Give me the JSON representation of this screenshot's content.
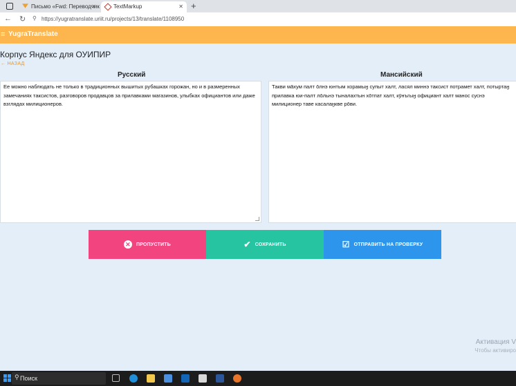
{
  "browser": {
    "tabs": [
      {
        "title": "Письмо «Fwd: Переводчики и э",
        "active": false
      },
      {
        "title": "TextMarkup",
        "active": true
      }
    ],
    "new_tab": "+",
    "url": "https://yugratranslate.uriit.ru/projects/13/translate/1108950"
  },
  "app": {
    "brand": "YugraTranslate",
    "page_title": "Корпус Яндекс для ОУИПИР",
    "back_label": "НАЗАД",
    "accent": "#fdb54d"
  },
  "source": {
    "language": "Русский",
    "text": "Ее можно наблюдать не только в традиционных вышитых рубашках горожан, но и в размеренных замечаниях таксистов, разговоров продавцов за прилавками магазинов, улыбках официантов или даже взглядах милиционеров."
  },
  "target": {
    "language": "Мансийский",
    "text": "Такви мāхум палт ōлнэ юнтым хорамыӈ супыт халт,  ласял миннэ таксист потрамет халт, потыртаӈ прилавка юи-палт лōльнэ тыналахтын хōтпат халт, кӯнъгыӈ официант халт манос суснэ милиционер таве касалаӈкве рōви."
  },
  "actions": {
    "skip": "ПРОПУСТИТЬ",
    "save": "СОХРАНИТЬ",
    "send": "ОТПРАВИТЬ НА ПРОВЕРКУ"
  },
  "watermark": {
    "title": "Активация V",
    "subtitle": "Чтобы активиро"
  },
  "taskbar": {
    "search_label": "Поиск"
  }
}
